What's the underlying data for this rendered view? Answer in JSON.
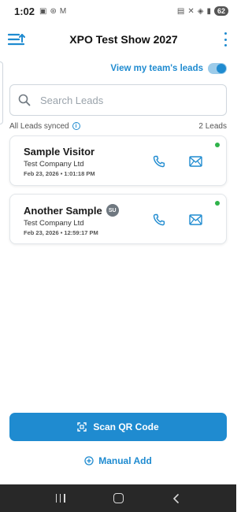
{
  "status_bar": {
    "time": "1:02",
    "battery": "62"
  },
  "header": {
    "title": "XPO Test Show 2027"
  },
  "team_toggle": {
    "label": "View my team's leads",
    "enabled": true
  },
  "search": {
    "placeholder": "Search Leads",
    "value": ""
  },
  "sync": {
    "status_text": "All Leads synced",
    "count_text": "2 Leads"
  },
  "leads": [
    {
      "name": "Sample Visitor",
      "company": "Test Company Ltd",
      "date": "Feb 23, 2026 • 1:01:18 PM",
      "initials": ""
    },
    {
      "name": "Another Sample",
      "company": "Test Company Ltd",
      "date": "Feb 23, 2026 • 12:59:17 PM",
      "initials": "SU"
    }
  ],
  "actions": {
    "scan_label": "Scan QR Code",
    "manual_add_label": "Manual Add"
  },
  "colors": {
    "accent": "#1f8bd0",
    "online": "#2fb34a",
    "nav_bar": "#282828"
  },
  "icons": {
    "menu": "menu-icon",
    "kebab": "kebab-icon",
    "search": "search-icon",
    "info": "info-icon",
    "call": "call-icon",
    "mail": "mail-icon",
    "scan": "scan-qr-icon",
    "plus": "plus-circle-icon"
  }
}
